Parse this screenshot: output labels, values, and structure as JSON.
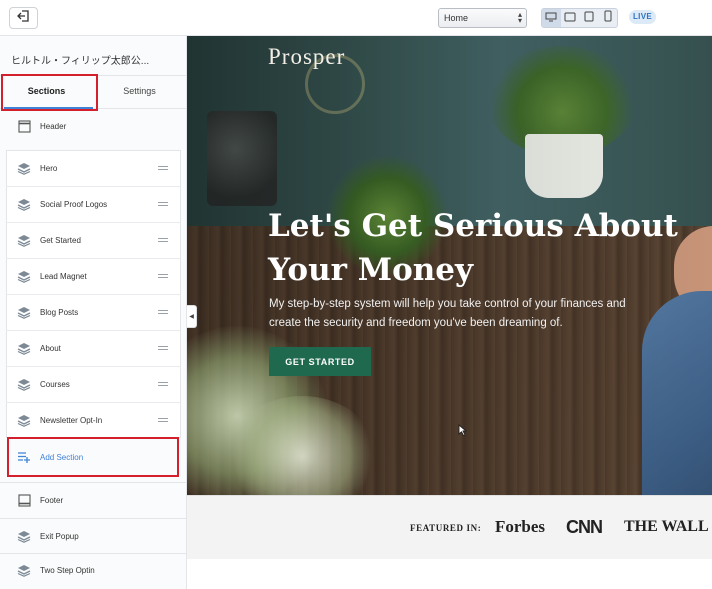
{
  "topbar": {
    "page_select_value": "Home",
    "live_label": "LIVE"
  },
  "sidebar": {
    "site_title": "ヒルトル・フィリップ太郎公...",
    "tabs": [
      {
        "label": "Sections",
        "active": true
      },
      {
        "label": "Settings",
        "active": false
      }
    ],
    "header_label": "Header",
    "sections": [
      {
        "label": "Hero"
      },
      {
        "label": "Social Proof Logos"
      },
      {
        "label": "Get Started"
      },
      {
        "label": "Lead Magnet"
      },
      {
        "label": "Blog Posts"
      },
      {
        "label": "About"
      },
      {
        "label": "Courses"
      },
      {
        "label": "Newsletter Opt-In"
      }
    ],
    "add_section_label": "Add Section",
    "footer_label": "Footer",
    "popups": [
      {
        "label": "Exit Popup"
      },
      {
        "label": "Two Step Optin"
      }
    ]
  },
  "preview": {
    "brand": "Prosper",
    "headline": "Let's Get Serious About Your Money",
    "subtext": "My step-by-step system will help you take control of your finances and create the security and freedom you've been dreaming of.",
    "cta_label": "GET STARTED",
    "featured_label": "FEATURED IN:",
    "featured_logos": [
      "Forbes",
      "CNN",
      "THE WALL STREET"
    ]
  },
  "colors": {
    "accent": "#3f82d6",
    "highlight": "#d4202c",
    "cta": "#1f6a4f"
  }
}
